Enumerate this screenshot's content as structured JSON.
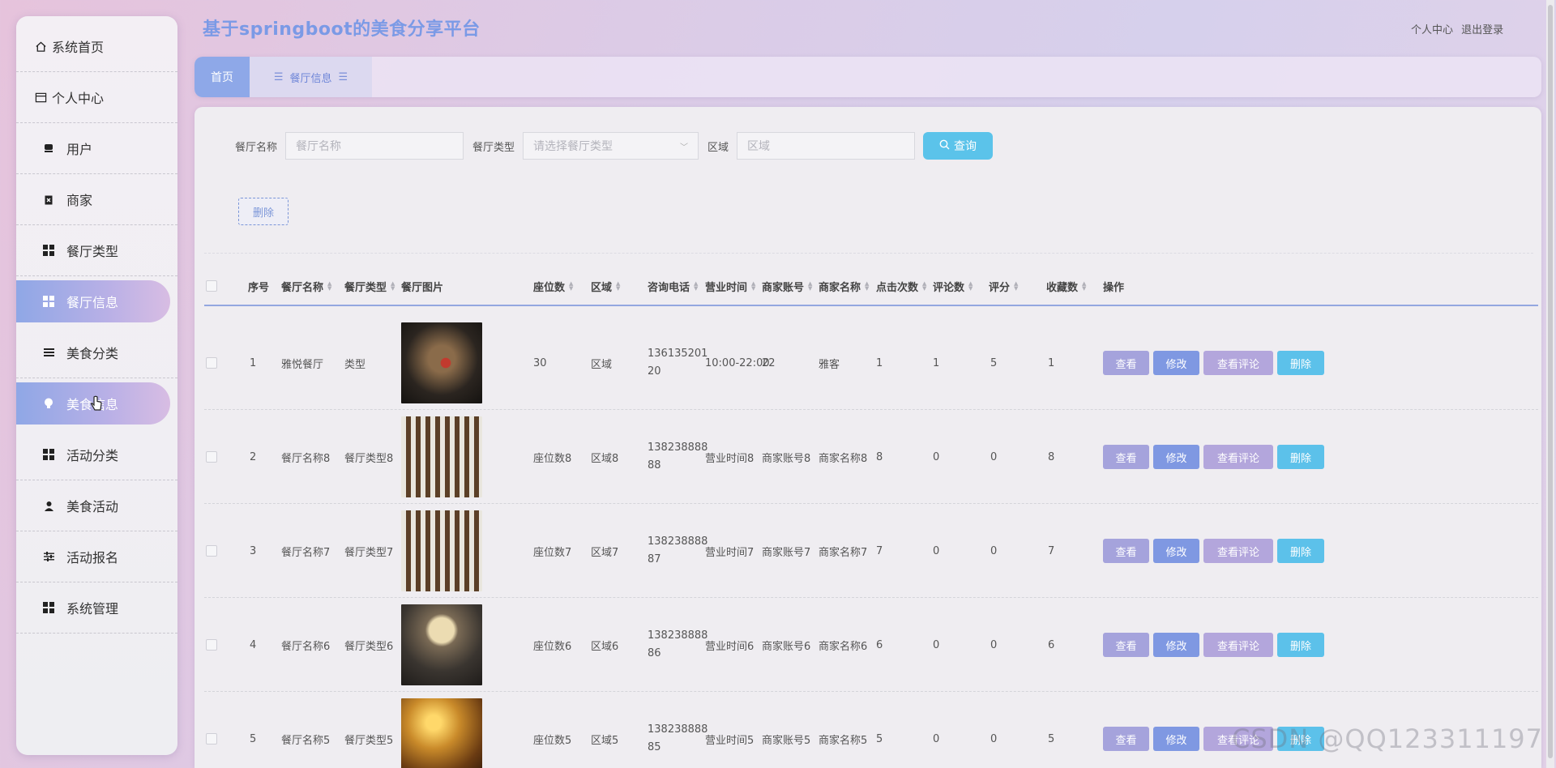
{
  "app": {
    "title": "基于springboot的美食分享平台"
  },
  "header": {
    "profile": "个人中心",
    "logout": "退出登录"
  },
  "sidebar": {
    "items": [
      {
        "label": "系统首页",
        "icon": "home-icon"
      },
      {
        "label": "个人中心",
        "icon": "profile-card-icon"
      },
      {
        "label": "用户",
        "icon": "user-block-icon"
      },
      {
        "label": "商家",
        "icon": "clipboard-icon"
      },
      {
        "label": "餐厅类型",
        "icon": "grid-icon"
      },
      {
        "label": "餐厅信息",
        "icon": "grid-icon",
        "active": true
      },
      {
        "label": "美食分类",
        "icon": "list-icon"
      },
      {
        "label": "美食信息",
        "icon": "bulb-icon",
        "active": true
      },
      {
        "label": "活动分类",
        "icon": "grid-icon"
      },
      {
        "label": "美食活动",
        "icon": "person-icon"
      },
      {
        "label": "活动报名",
        "icon": "sliders-icon"
      },
      {
        "label": "系统管理",
        "icon": "grid-icon"
      }
    ]
  },
  "tabs": {
    "home": "首页",
    "current": "餐厅信息"
  },
  "search": {
    "name_label": "餐厅名称",
    "name_placeholder": "餐厅名称",
    "type_label": "餐厅类型",
    "type_placeholder": "请选择餐厅类型",
    "area_label": "区域",
    "area_placeholder": "区域",
    "query_button": "查询"
  },
  "bulk_delete": "删除",
  "table": {
    "headers": [
      "序号",
      "餐厅名称",
      "餐厅类型",
      "餐厅图片",
      "座位数",
      "区域",
      "咨询电话",
      "营业时间",
      "商家账号",
      "商家名称",
      "点击次数",
      "评论数",
      "评分",
      "收藏数",
      "操作"
    ],
    "actions": {
      "view": "查看",
      "edit": "修改",
      "comments": "查看评论",
      "delete": "删除"
    },
    "rows": [
      {
        "no": "1",
        "name": "雅悦餐厅",
        "type": "类型",
        "seats": "30",
        "area": "区域",
        "phone1": "136135201",
        "phone2": "20",
        "hours": "10:00-22:00",
        "account": "22",
        "merchant": "雅客",
        "clicks": "1",
        "comments": "1",
        "score": "5",
        "favorites": "1"
      },
      {
        "no": "2",
        "name": "餐厅名称8",
        "type": "餐厅类型8",
        "seats": "座位数8",
        "area": "区域8",
        "phone1": "138238888",
        "phone2": "88",
        "hours": "营业时间8",
        "account": "商家账号8",
        "merchant": "商家名称8",
        "clicks": "8",
        "comments": "0",
        "score": "0",
        "favorites": "8"
      },
      {
        "no": "3",
        "name": "餐厅名称7",
        "type": "餐厅类型7",
        "seats": "座位数7",
        "area": "区域7",
        "phone1": "138238888",
        "phone2": "87",
        "hours": "营业时间7",
        "account": "商家账号7",
        "merchant": "商家名称7",
        "clicks": "7",
        "comments": "0",
        "score": "0",
        "favorites": "7"
      },
      {
        "no": "4",
        "name": "餐厅名称6",
        "type": "餐厅类型6",
        "seats": "座位数6",
        "area": "区域6",
        "phone1": "138238888",
        "phone2": "86",
        "hours": "营业时间6",
        "account": "商家账号6",
        "merchant": "商家名称6",
        "clicks": "6",
        "comments": "0",
        "score": "0",
        "favorites": "6"
      },
      {
        "no": "5",
        "name": "餐厅名称5",
        "type": "餐厅类型5",
        "seats": "座位数5",
        "area": "区域5",
        "phone1": "138238888",
        "phone2": "85",
        "hours": "营业时间5",
        "account": "商家账号5",
        "merchant": "商家名称5",
        "clicks": "5",
        "comments": "0",
        "score": "0",
        "favorites": "5"
      }
    ]
  },
  "watermark": "CSDN @QQ123311197"
}
